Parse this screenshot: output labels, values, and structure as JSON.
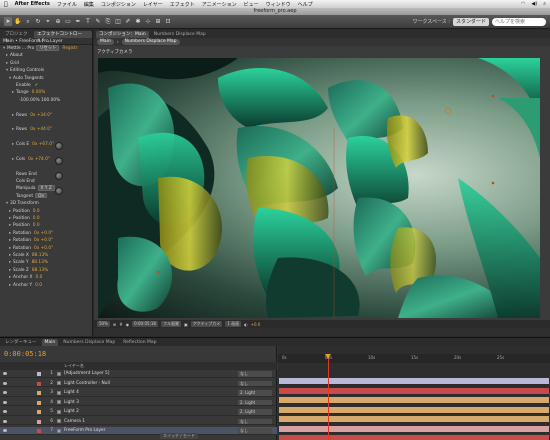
{
  "menubar": {
    "app": "After Effects",
    "items": [
      "ファイル",
      "編集",
      "コンポジション",
      "レイヤー",
      "エフェクト",
      "アニメーション",
      "ビュー",
      "ウィンドウ",
      "ヘルプ"
    ]
  },
  "window": {
    "title": "freeform_pro.aep"
  },
  "toolbar": {
    "workspace_label": "ワークスペース :",
    "workspace_value": "スタンダード",
    "search_placeholder": "ヘルプを検索"
  },
  "effects_panel": {
    "tabs": [
      "プロジェクト",
      "エフェクトコントロール：..."
    ],
    "header": "Main • FreeForm Pro Layer",
    "rows": [
      {
        "ar": "▾",
        "text": "Mettle ... Pro",
        "btn": "リセット",
        "val": "Registr"
      },
      {
        "ar": "▸",
        "text": "About"
      },
      {
        "ar": "▸",
        "text": "Grid"
      },
      {
        "ar": "▾",
        "text": "Editing Controls"
      },
      {
        "ar": "▾",
        "text": "Auto Tangents"
      },
      {
        "ar": "",
        "text": "Enable",
        "check": "✓"
      },
      {
        "ar": "▸",
        "text": "Tange",
        "val": "0.00%"
      },
      {
        "ar": "",
        "text": "-100.00%    100.00%"
      },
      {
        "ar": "",
        "text": ""
      },
      {
        "ar": "▸",
        "text": "Rows",
        "val": "0x +34.0°"
      },
      {
        "ar": "",
        "text": ""
      },
      {
        "ar": "▸",
        "text": "Rows",
        "val": "0x +44.0°"
      },
      {
        "ar": "",
        "text": ""
      },
      {
        "ar": "▸",
        "text": "Cols E",
        "val": "0x +67.0°"
      },
      {
        "ar": "",
        "text": ""
      },
      {
        "ar": "▸",
        "text": "Cols",
        "val": "0x +74.0°"
      },
      {
        "ar": "",
        "text": ""
      },
      {
        "ar": "",
        "text": "Rows End"
      },
      {
        "ar": "",
        "text": "Cols End"
      },
      {
        "ar": "",
        "text": "Manipula",
        "btn": "X Y Z"
      },
      {
        "ar": "",
        "text": "Tangent",
        "btn": "On"
      },
      {
        "ar": "▾",
        "text": "3D Transform"
      },
      {
        "ar": "▸",
        "text": "Position",
        "val": "0.0"
      },
      {
        "ar": "▸",
        "text": "Position",
        "val": "0.0"
      },
      {
        "ar": "▸",
        "text": "Position",
        "val": "0.0"
      },
      {
        "ar": "▸",
        "text": "Rotation",
        "val": "0x +0.0°"
      },
      {
        "ar": "▸",
        "text": "Rotation",
        "val": "0x +0.0°"
      },
      {
        "ar": "▸",
        "text": "Rotation",
        "val": "0x +0.0°"
      },
      {
        "ar": "▸",
        "text": "Scale X",
        "val": "88.13%"
      },
      {
        "ar": "▸",
        "text": "Scale Y",
        "val": "88.13%"
      },
      {
        "ar": "▸",
        "text": "Scale Z",
        "val": "88.13%"
      },
      {
        "ar": "▸",
        "text": "Anchor X",
        "val": "0.0"
      },
      {
        "ar": "▸",
        "text": "Anchor Y",
        "val": "0.0"
      }
    ]
  },
  "comp_panel": {
    "tabs": [
      "コンポジション：Main",
      "Numbers Displace Map"
    ],
    "crumbs": [
      "Main",
      "Numbers Displace Map"
    ],
    "camera": "アクティブカメラ",
    "footer": [
      "50%",
      "0:00:05:18",
      "フル画質",
      "アクティブカメ",
      "1 画面"
    ],
    "footer_value": "+0.0"
  },
  "timeline": {
    "tabs": [
      "レンダーキュー",
      "Main",
      "Numbers Displace Map",
      "Reflection Map"
    ],
    "timecode": "0:00:05:18",
    "header": "レイヤー名",
    "ruler": [
      "0s",
      "05s",
      "10s",
      "15s",
      "20s",
      "25s"
    ],
    "layers": [
      {
        "num": "1",
        "name": "[Adjustment Layer 5]",
        "parent": "なし",
        "color": "#b9b9d9"
      },
      {
        "num": "2",
        "name": "Light Controller - Null",
        "parent": "なし",
        "color": "#c84b4b"
      },
      {
        "num": "3",
        "name": "Light 4",
        "parent": "2. Light",
        "color": "#d8a96a"
      },
      {
        "num": "4",
        "name": "Light 3",
        "parent": "2. Light",
        "color": "#d8a96a"
      },
      {
        "num": "5",
        "name": "Light 2",
        "parent": "2. Light",
        "color": "#d8a96a"
      },
      {
        "num": "6",
        "name": "Camera 1",
        "parent": "なし",
        "color": "#d9a0a0"
      },
      {
        "num": "7",
        "name": "FreeForm Pro Layer",
        "parent": "なし",
        "color": "#c84b4b"
      }
    ],
    "footer": "スイッチ / モード"
  }
}
